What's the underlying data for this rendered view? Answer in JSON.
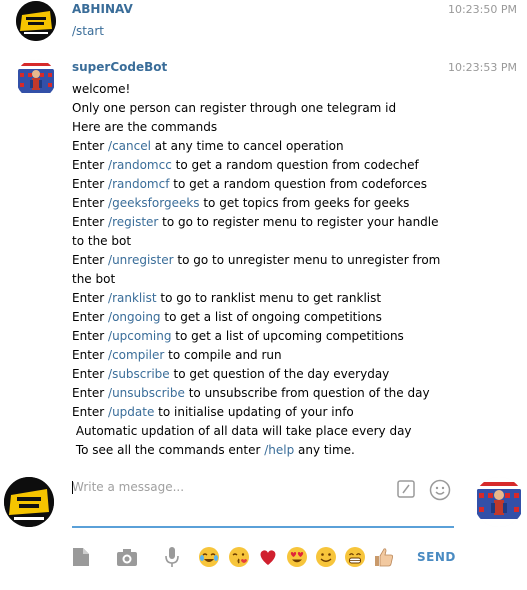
{
  "messages": [
    {
      "author": "ABHINAV",
      "time": "10:23:50 PM",
      "lines": [
        "/start"
      ]
    },
    {
      "author": "superCodeBot",
      "time": "10:23:53 PM",
      "intro": [
        "welcome!",
        "Only one person can register through one telegram id",
        "Here are the commands"
      ],
      "commands": [
        {
          "prefix": "Enter ",
          "cmd": "/cancel",
          "suffix": " at any time to cancel operation"
        },
        {
          "prefix": "Enter ",
          "cmd": "/randomcc",
          "suffix": " to get a random question from codechef"
        },
        {
          "prefix": "Enter ",
          "cmd": "/randomcf",
          "suffix": " to get a random question from codeforces"
        },
        {
          "prefix": "Enter ",
          "cmd": "/geeksforgeeks",
          "suffix": " to get topics from geeks for geeks"
        },
        {
          "prefix": "Enter ",
          "cmd": "/register",
          "suffix": " to go to register menu to register your handle to the bot"
        },
        {
          "prefix": "Enter ",
          "cmd": "/unregister",
          "suffix": " to go to unregister menu to unregister from the bot"
        },
        {
          "prefix": "Enter ",
          "cmd": "/ranklist",
          "suffix": " to go to ranklist menu to get ranklist"
        },
        {
          "prefix": "Enter ",
          "cmd": "/ongoing",
          "suffix": " to get a list of ongoing competitions"
        },
        {
          "prefix": "Enter ",
          "cmd": "/upcoming",
          "suffix": " to get a list of upcoming competitions"
        },
        {
          "prefix": "Enter ",
          "cmd": "/compiler",
          "suffix": " to compile and run"
        },
        {
          "prefix": "Enter ",
          "cmd": "/subscribe",
          "suffix": " to get question of the day everyday"
        },
        {
          "prefix": "Enter ",
          "cmd": "/unsubscribe",
          "suffix": " to unsubscribe from question of the day"
        },
        {
          "prefix": "Enter ",
          "cmd": "/update",
          "suffix": " to initialise updating of your info"
        }
      ],
      "footer_line1": " Automatic updation of all data will take place every day",
      "footer_line2": {
        "prefix": " To see all the commands enter ",
        "cmd": "/help",
        "suffix": " any time."
      }
    }
  ],
  "composer": {
    "placeholder": "Write a message...",
    "value": "",
    "send_label": "SEND"
  },
  "icons": {
    "attach": "document-icon",
    "camera": "camera-icon",
    "mic": "microphone-icon",
    "emojis": [
      "joy-emoji",
      "kiss-emoji",
      "heart-emoji",
      "heart-eyes-emoji",
      "smile-emoji",
      "grin-emoji",
      "thumbs-up-emoji"
    ]
  },
  "colors": {
    "link": "#3a6d99",
    "accent": "#5aa0d8",
    "time": "#999999",
    "send": "#4a8bc2"
  }
}
